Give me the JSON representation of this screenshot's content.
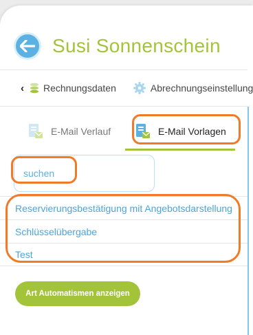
{
  "header": {
    "title": "Susi Sonnenschein"
  },
  "nav": {
    "items": [
      {
        "label": "Rechnungsdaten"
      },
      {
        "label": "Abrechnungseinstellungen"
      }
    ]
  },
  "tabs": [
    {
      "label": "E-Mail Verlauf",
      "active": false
    },
    {
      "label": "E-Mail Vorlagen",
      "active": true
    }
  ],
  "search": {
    "placeholder": "suchen"
  },
  "templates": [
    "Reservierungsbestätigung mit Angebotsdarstellung",
    "Schlüsselübergabe",
    "Test"
  ],
  "actions": {
    "automations_label": "Art Automatismen anzeigen"
  },
  "colors": {
    "accent_green": "#a3c43a",
    "accent_blue": "#5bb1e1",
    "highlight_orange": "#f07a25"
  }
}
